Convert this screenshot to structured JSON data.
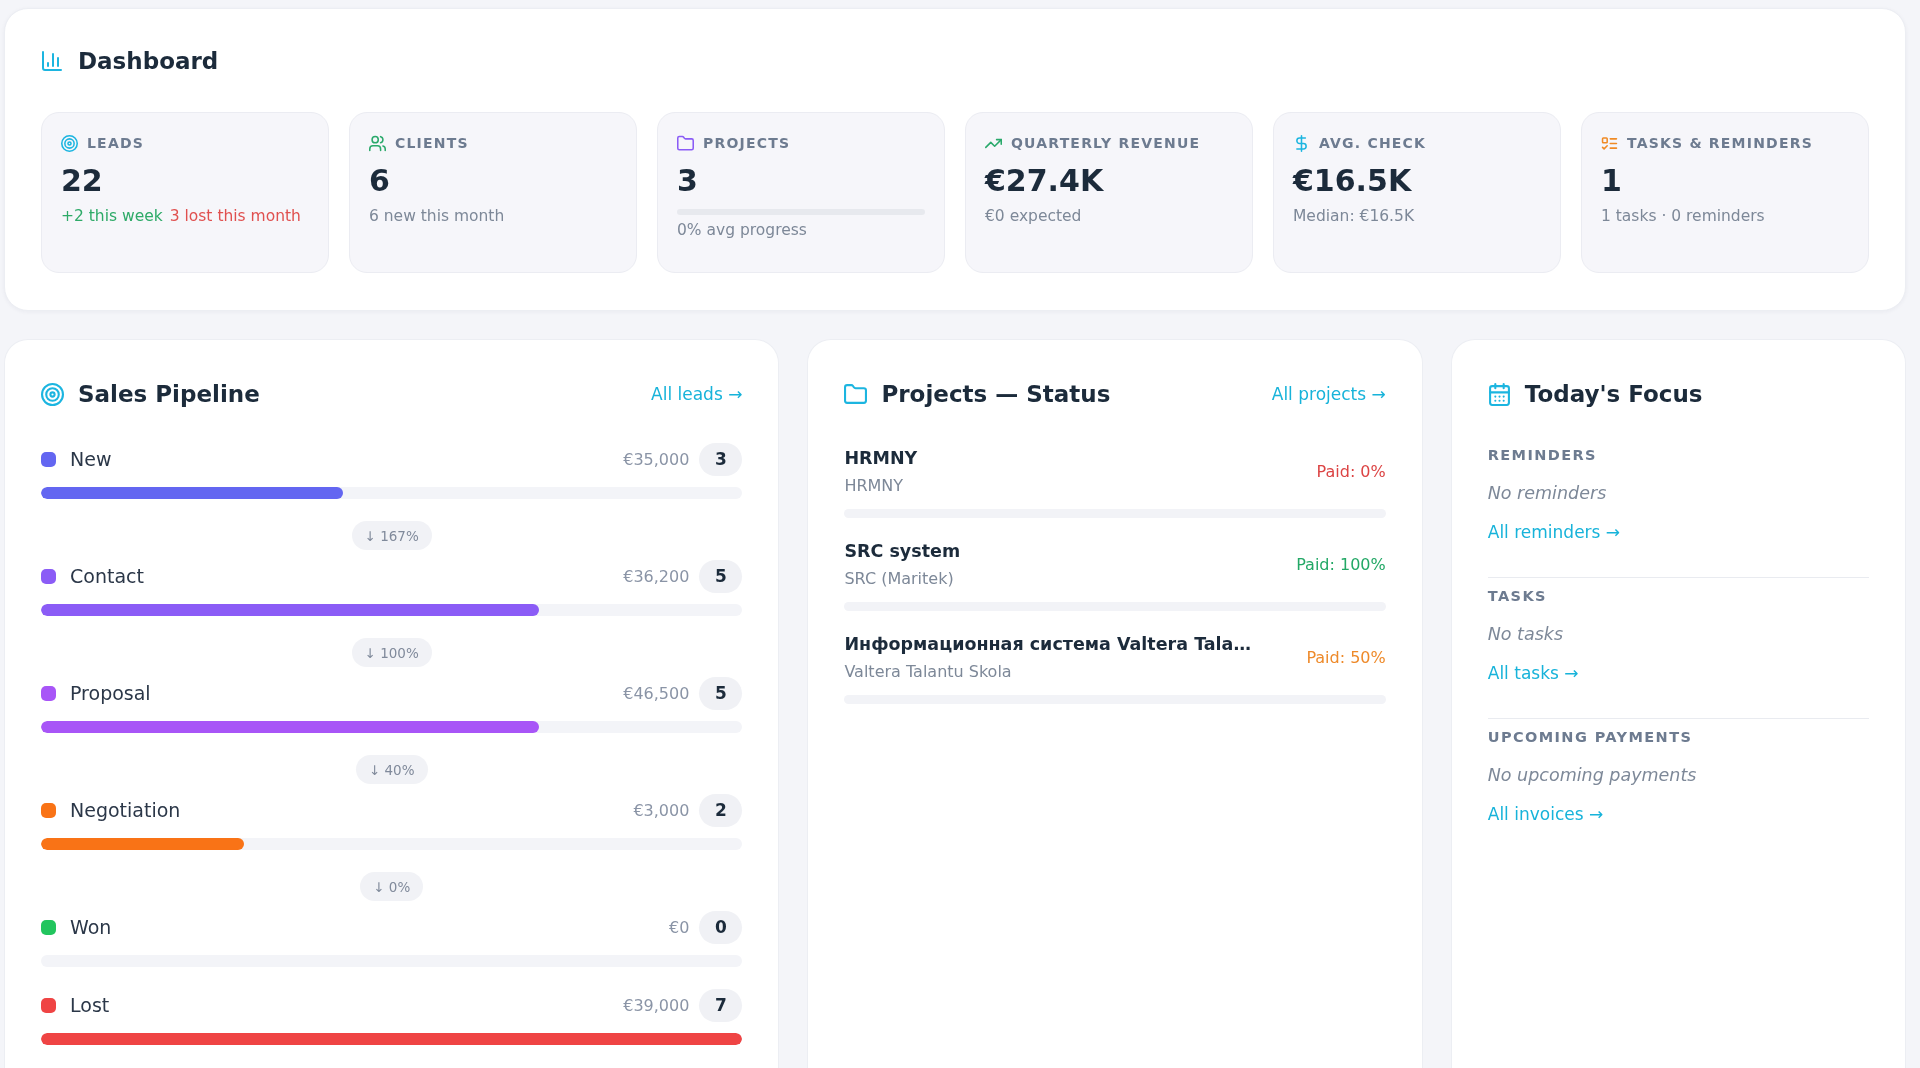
{
  "dashboard": {
    "title": "Dashboard"
  },
  "kpis": [
    {
      "label": "LEADS",
      "value": "22",
      "notes": [
        {
          "text": "+2 this week",
          "kind": "gain"
        },
        {
          "text": "3 lost this month",
          "kind": "loss"
        }
      ]
    },
    {
      "label": "CLIENTS",
      "value": "6",
      "notes": [
        {
          "text": "6 new this month",
          "kind": "plain"
        }
      ]
    },
    {
      "label": "PROJECTS",
      "value": "3",
      "progress_bar": true,
      "notes": [
        {
          "text": "0% avg progress",
          "kind": "plain"
        }
      ]
    },
    {
      "label": "QUARTERLY REVENUE",
      "value": "€27.4K",
      "notes": [
        {
          "text": "€0 expected",
          "kind": "plain"
        }
      ]
    },
    {
      "label": "AVG. CHECK",
      "value": "€16.5K",
      "notes": [
        {
          "text": "Median: €16.5K",
          "kind": "plain"
        }
      ]
    },
    {
      "label": "TASKS & REMINDERS",
      "value": "1",
      "notes": [
        {
          "text": "1 tasks · 0 reminders",
          "kind": "plain"
        }
      ]
    }
  ],
  "sales_pipeline": {
    "title": "Sales Pipeline",
    "link": "All leads →",
    "stages": [
      {
        "name": "New",
        "color": "#6366f1",
        "amount": "€35,000",
        "count": "3",
        "level": 0.43,
        "conversion": "↓ 167%"
      },
      {
        "name": "Contact",
        "color": "#8b5cf6",
        "amount": "€36,200",
        "count": "5",
        "level": 0.71,
        "conversion": "↓ 100%"
      },
      {
        "name": "Proposal",
        "color": "#a855f7",
        "amount": "€46,500",
        "count": "5",
        "level": 0.71,
        "conversion": "↓ 40%"
      },
      {
        "name": "Negotiation",
        "color": "#f97316",
        "amount": "€3,000",
        "count": "2",
        "level": 0.29,
        "conversion": "↓ 0%"
      },
      {
        "name": "Won",
        "color": "#22c55e",
        "amount": "€0",
        "count": "0"
      },
      {
        "name": "Lost",
        "color": "#ef4444",
        "amount": "€39,000",
        "count": "7",
        "level": 1
      }
    ]
  },
  "projects_status": {
    "title": "Projects — Status",
    "link": "All projects →",
    "items": [
      {
        "name": "HRMNY",
        "client": "HRMNY",
        "paid": "Paid: 0%",
        "kind": "unpaid"
      },
      {
        "name": "SRC system",
        "client": "SRC (Maritek)",
        "paid": "Paid: 100%",
        "kind": "paid"
      },
      {
        "name": "Информационная система Valtera Tala…",
        "client": "Valtera Talantu Skola",
        "paid": "Paid: 50%",
        "kind": "partial"
      }
    ]
  },
  "todays_focus": {
    "title": "Today's Focus",
    "sections": [
      {
        "heading": "REMINDERS",
        "empty": "No reminders",
        "link": "All reminders →"
      },
      {
        "heading": "TASKS",
        "empty": "No tasks",
        "link": "All tasks →"
      },
      {
        "heading": "UPCOMING PAYMENTS",
        "empty": "No upcoming payments",
        "link": "All invoices →"
      }
    ]
  }
}
